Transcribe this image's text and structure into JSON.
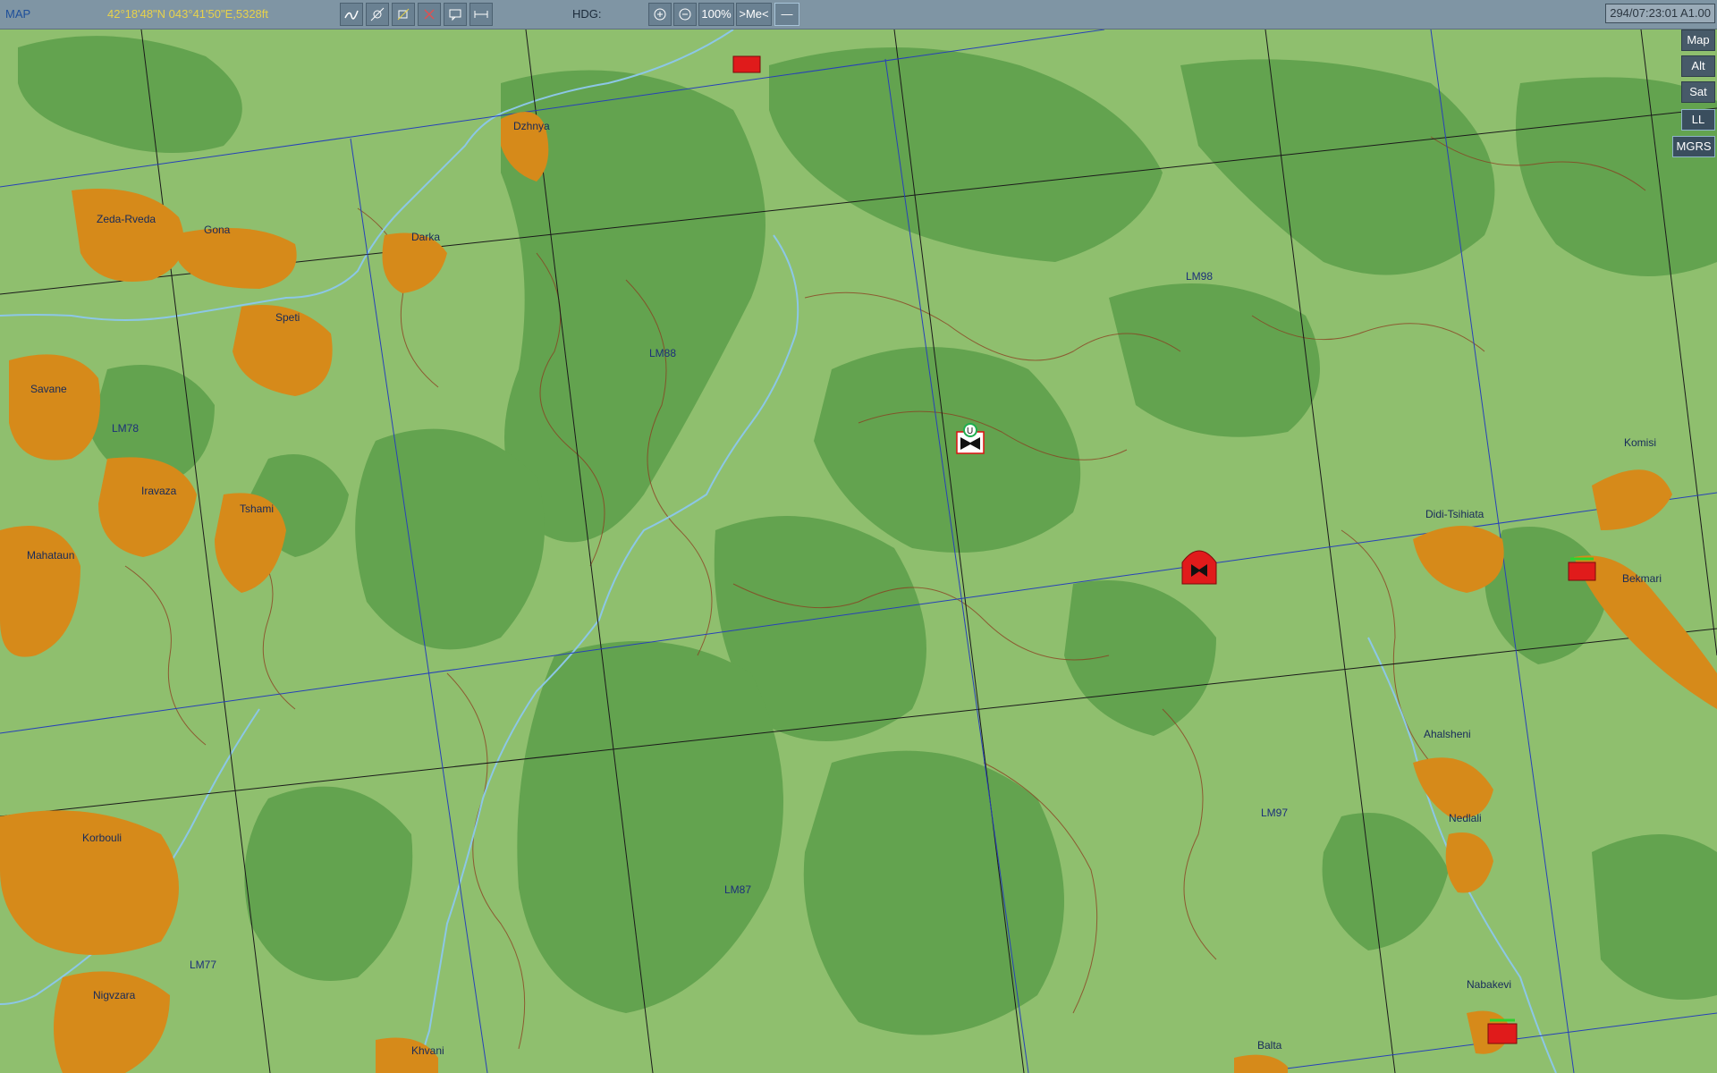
{
  "toolbar": {
    "map_label": "MAP",
    "coordinates": "42°18'48\"N 043°41'50\"E,5328ft",
    "hdg_label": "HDG:",
    "zoom": "100%",
    "me_button": ">Me<",
    "line_button": "—",
    "timestamp": "294/07:23:01 A1.00",
    "tools": [
      "route-tool-icon",
      "waypoint-tool-icon",
      "unit-tool-icon",
      "delete-tool-icon",
      "comment-tool-icon",
      "ruler-tool-icon"
    ],
    "zoom_in_icon": "plus-icon",
    "zoom_out_icon": "minus-icon"
  },
  "side_buttons": [
    "Map",
    "Alt",
    "Sat",
    "LL",
    "MGRS"
  ],
  "colors": {
    "terrain_light": "#8fbf6e",
    "forest": "#63a34f",
    "town": "#d68a1a",
    "grid_black": "#1a1a1a",
    "grid_blue": "#2741b8",
    "river": "#8cc7e6",
    "contour": "#8b3a1e",
    "enemy": "#e01b1b",
    "coordinate_text": "#e8d24a"
  },
  "towns": [
    "Dzhnya",
    "Zeda-Rveda",
    "Gona",
    "Darka",
    "Speti",
    "Savane",
    "Iravaza",
    "Tshami",
    "Mahataun",
    "Korbouli",
    "Nigvzara",
    "Khvani",
    "Komisi",
    "Didi-Tsihiata",
    "Bekmari",
    "Ahalsheni",
    "Nedlali",
    "Nabakevi",
    "Balta"
  ],
  "grid_labels": [
    "LM88",
    "LM98",
    "LM78",
    "LM97",
    "LM87",
    "LM77"
  ],
  "units": [
    "player-aircraft-icon",
    "enemy-unit-icon",
    "enemy-unit-icon",
    "enemy-unit-icon",
    "enemy-unit-icon"
  ]
}
